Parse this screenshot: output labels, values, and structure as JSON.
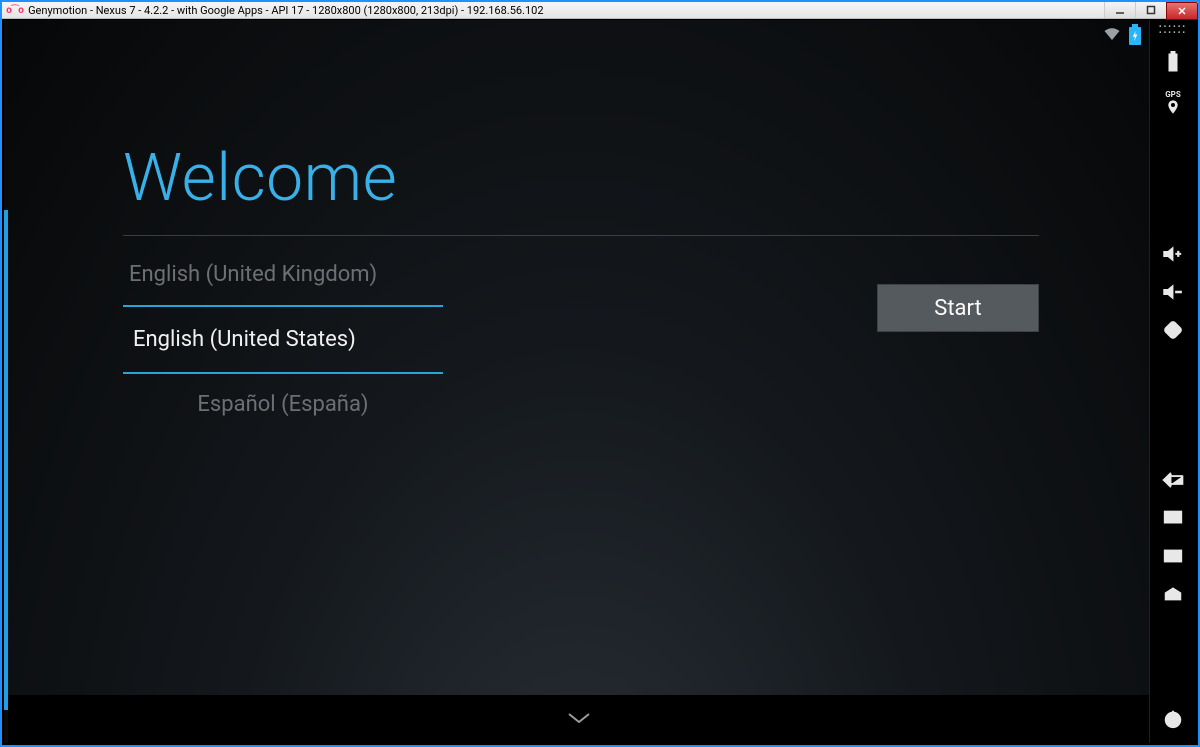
{
  "window": {
    "title": "Genymotion - Nexus 7 - 4.2.2 - with Google Apps - API 17 - 1280x800 (1280x800, 213dpi) - 192.168.56.102"
  },
  "setup": {
    "title": "Welcome",
    "langs": {
      "prev": "English (United Kingdom)",
      "selected": "English (United States)",
      "next": "Español (España)"
    },
    "start_label": "Start"
  },
  "sidebar": {
    "gps_label": "GPS"
  }
}
